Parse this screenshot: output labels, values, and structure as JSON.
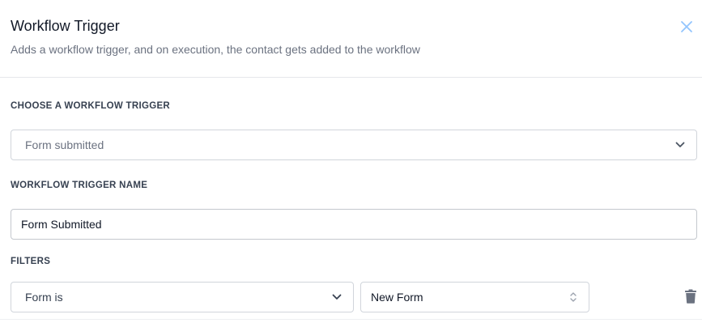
{
  "header": {
    "title": "Workflow Trigger",
    "subtitle": "Adds a workflow trigger, and on execution, the contact gets added to the workflow",
    "close_icon": "close-icon"
  },
  "trigger": {
    "section_label": "CHOOSE A WORKFLOW TRIGGER",
    "selected_value": "Form submitted",
    "chevron_icon": "chevron-down-icon"
  },
  "trigger_name": {
    "section_label": "WORKFLOW TRIGGER NAME",
    "value": "Form Submitted"
  },
  "filters": {
    "section_label": "FILTERS",
    "items": [
      {
        "field_value": "Form is",
        "value_value": "New Form",
        "field_icon": "chevron-down-icon",
        "value_icon": "chevron-up-down-icon",
        "delete_icon": "trash-icon"
      }
    ]
  },
  "colors": {
    "label": "#374151",
    "muted_text": "#6b7280",
    "border": "#d1d5db",
    "icon": "#6b7280"
  }
}
